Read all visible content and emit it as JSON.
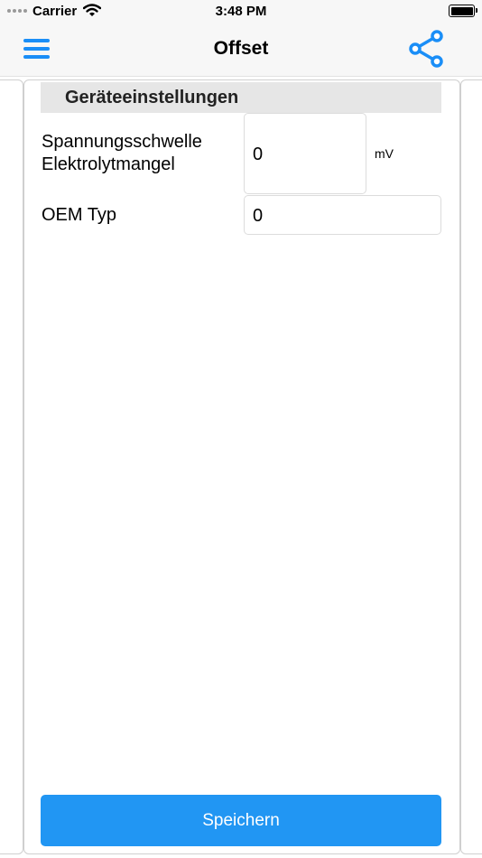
{
  "status_bar": {
    "carrier": "Carrier",
    "time": "3:48 PM"
  },
  "nav": {
    "title": "Offset",
    "menu_icon": "hamburger-menu-icon",
    "share_icon": "share-icon",
    "accent_color": "#1a8ef7"
  },
  "section": {
    "title": "Geräteeinstellungen"
  },
  "fields": {
    "voltage_label_line1": "Spannungsschwelle",
    "voltage_label_line2": "Elektrolytmangel",
    "voltage_value": "0",
    "voltage_unit": "mV",
    "oem_label": "OEM Typ",
    "oem_value": "0"
  },
  "actions": {
    "save_label": "Speichern",
    "save_color": "#2196f3"
  }
}
